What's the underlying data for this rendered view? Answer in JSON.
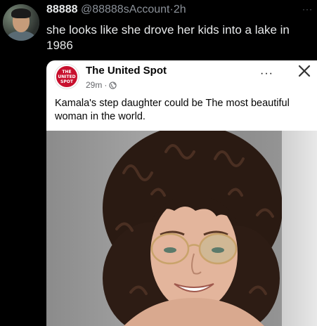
{
  "tweet": {
    "display_name": "88888",
    "handle": "@88888sAccount",
    "separator": "·",
    "time": "2h",
    "text": "she looks like she drove her kids into a lake in 1986",
    "more_label": "···"
  },
  "embed": {
    "logo_line1": "THE",
    "logo_line2": "UNITED",
    "logo_line3": "SPOT",
    "page_name": "The United Spot",
    "time": "29m",
    "separator": "·",
    "more_label": "···",
    "post_text": "Kamala's step daughter could be The most beautiful woman in the world."
  },
  "colors": {
    "background": "#000000",
    "text_primary": "#e7e9ea",
    "text_secondary": "#8b9199",
    "logo_red": "#c8102e"
  }
}
